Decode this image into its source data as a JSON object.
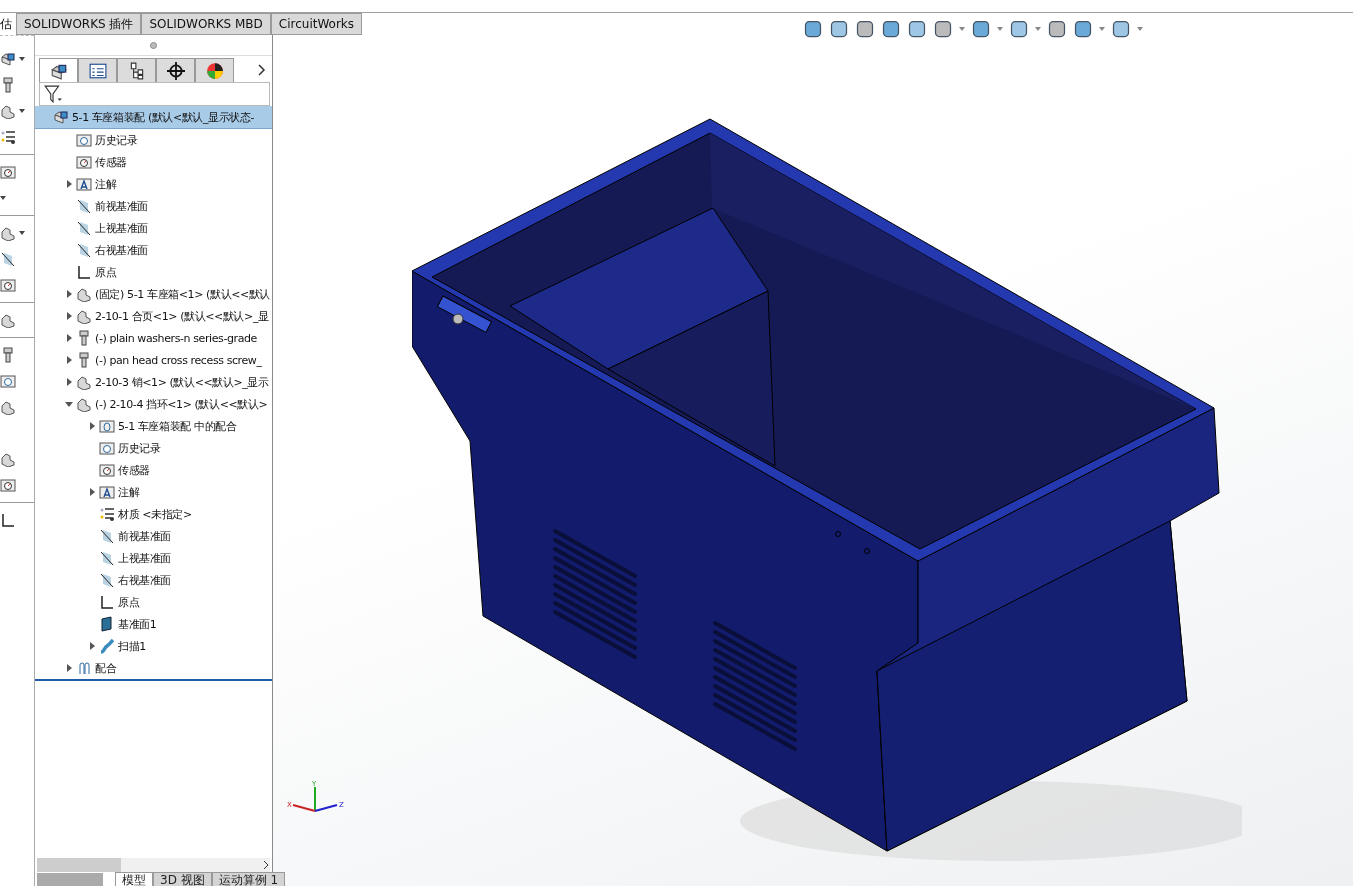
{
  "top_tabs": [
    {
      "label": "估"
    },
    {
      "label": "SOLIDWORKS 插件",
      "selected": false
    },
    {
      "label": "SOLIDWORKS MBD",
      "selected": false
    },
    {
      "label": "CircuitWorks",
      "selected": false
    }
  ],
  "panel_tabs": [
    {
      "kind": "feature",
      "selected": true
    },
    {
      "kind": "property",
      "selected": false
    },
    {
      "kind": "config",
      "selected": false
    },
    {
      "kind": "dim",
      "selected": false
    },
    {
      "kind": "display",
      "selected": false
    }
  ],
  "tree": [
    {
      "label": "5-1 车座箱装配  (默认<默认_显示状态-",
      "kind": "assembly",
      "selected": true,
      "children": [
        {
          "label": "历史记录",
          "kind": "history",
          "selected": false
        },
        {
          "label": "传感器",
          "kind": "sensor",
          "selected": false
        },
        {
          "label": "注解",
          "kind": "annotation",
          "expanded": false,
          "selected": false
        },
        {
          "label": "前视基准面",
          "kind": "plane",
          "selected": false
        },
        {
          "label": "上视基准面",
          "kind": "plane",
          "selected": false
        },
        {
          "label": "右视基准面",
          "kind": "plane",
          "selected": false
        },
        {
          "label": "原点",
          "kind": "origin",
          "selected": false
        },
        {
          "label": "(固定) 5-1 车座箱<1> (默认<<默认",
          "kind": "part",
          "expanded": false,
          "selected": false
        },
        {
          "label": "2-10-1 合页<1> (默认<<默认>_显",
          "kind": "part",
          "expanded": false,
          "selected": false
        },
        {
          "label": "(-) plain washers-n series-grade",
          "kind": "screw",
          "expanded": false,
          "selected": false
        },
        {
          "label": "(-) pan head cross recess screw_",
          "kind": "screw",
          "expanded": false,
          "selected": false
        },
        {
          "label": "2-10-3 销<1> (默认<<默认>_显示",
          "kind": "part",
          "expanded": false,
          "selected": false
        },
        {
          "label": "(-) 2-10-4 挡环<1> (默认<<默认>",
          "kind": "part",
          "expanded": true,
          "selected": false,
          "children": [
            {
              "label": "5-1 车座箱装配 中的配合",
              "kind": "matefolder",
              "expanded": false,
              "selected": false
            },
            {
              "label": "历史记录",
              "kind": "history",
              "selected": false
            },
            {
              "label": "传感器",
              "kind": "sensor",
              "selected": false
            },
            {
              "label": "注解",
              "kind": "annotation",
              "expanded": false,
              "selected": false
            },
            {
              "label": "材质 <未指定>",
              "kind": "material",
              "selected": false
            },
            {
              "label": "前视基准面",
              "kind": "plane",
              "selected": false
            },
            {
              "label": "上视基准面",
              "kind": "plane",
              "selected": false
            },
            {
              "label": "右视基准面",
              "kind": "plane",
              "selected": false
            },
            {
              "label": "原点",
              "kind": "origin",
              "selected": false
            },
            {
              "label": "基准面1",
              "kind": "refplane",
              "selected": false
            },
            {
              "label": "扫描1",
              "kind": "sweep",
              "expanded": false,
              "selected": false
            }
          ]
        },
        {
          "label": "配合",
          "kind": "mates",
          "expanded": false,
          "selected": false
        }
      ]
    }
  ],
  "bottom_tabs": [
    {
      "label": "模型",
      "selected": true
    },
    {
      "label": "3D 视图",
      "selected": false
    },
    {
      "label": "运动算例 1",
      "selected": false
    }
  ],
  "triad": {
    "x": "X",
    "y": "Y",
    "z": "Z"
  }
}
